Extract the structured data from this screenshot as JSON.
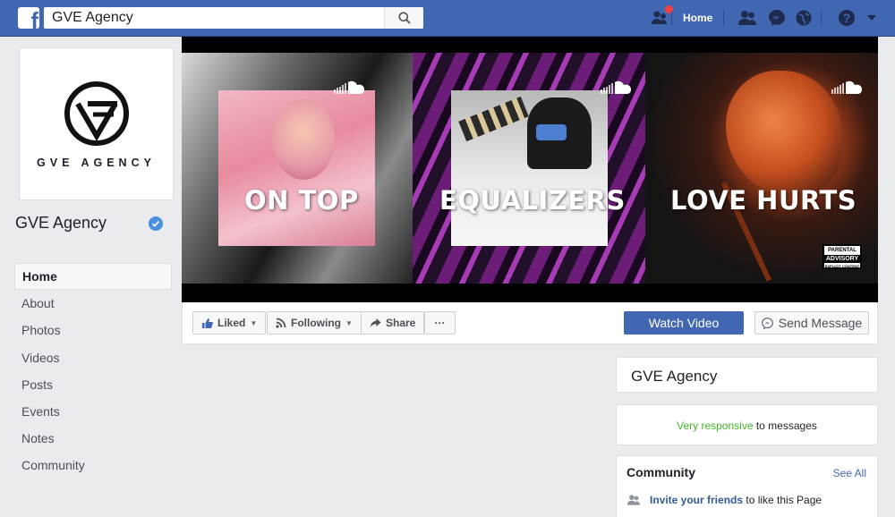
{
  "topbar": {
    "search_value": "GVE Agency",
    "home_label": "Home"
  },
  "profile": {
    "logo_text": "GVE AGENCY",
    "page_name": "GVE Agency"
  },
  "left_nav": {
    "items": [
      {
        "label": "Home",
        "active": true
      },
      {
        "label": "About"
      },
      {
        "label": "Photos"
      },
      {
        "label": "Videos"
      },
      {
        "label": "Posts"
      },
      {
        "label": "Events"
      },
      {
        "label": "Notes"
      },
      {
        "label": "Community"
      }
    ]
  },
  "cover": {
    "titles": [
      "ON TOP",
      "EQUALIZERS",
      "LOVE HURTS"
    ],
    "advisory": {
      "top": "PARENTAL",
      "mid": "ADVISORY",
      "bottom": "EXPLICIT CONTENT"
    }
  },
  "actions": {
    "liked": "Liked",
    "following": "Following",
    "share": "Share",
    "more": "···",
    "watch_video": "Watch Video",
    "send_message": "Send Message"
  },
  "cards": {
    "page_title": "GVE Agency",
    "responsive_highlight": "Very responsive",
    "responsive_rest": " to messages",
    "community_title": "Community",
    "see_all": "See All",
    "invite_link": "Invite your friends",
    "invite_rest": " to like this Page"
  },
  "colors": {
    "brand_blue": "#4267b2",
    "notification_red": "#fa3e3e",
    "verified_blue": "#4a90e2",
    "responsive_green": "#42b72a"
  }
}
